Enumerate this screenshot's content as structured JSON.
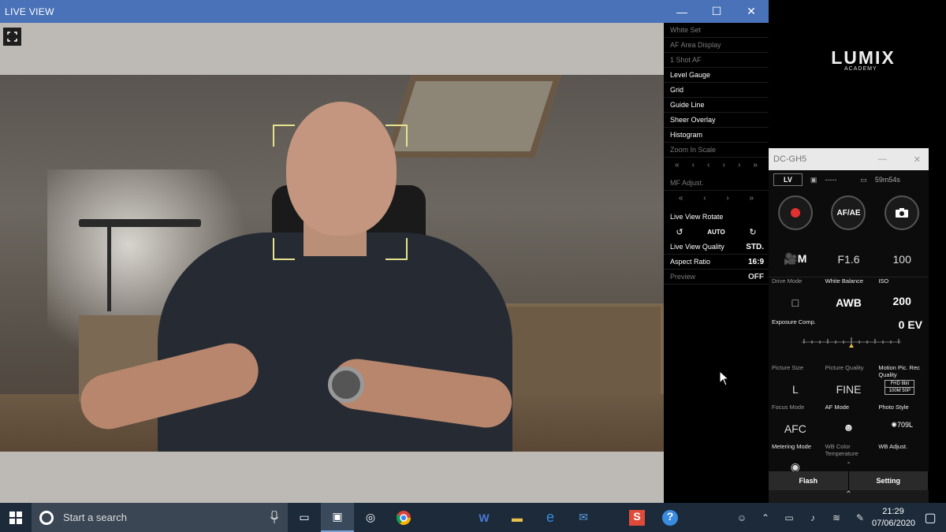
{
  "live_view_window": {
    "title": "LIVE VIEW",
    "window_buttons": {
      "minimize": "—",
      "maximize": "☐",
      "close": "✕"
    }
  },
  "settings_panel": {
    "items": [
      {
        "label": "White Set",
        "dim": true
      },
      {
        "label": "AF Area Display",
        "dim": true
      },
      {
        "label": "1 Shot AF",
        "dim": true
      },
      {
        "label": "Level Gauge",
        "dim": false
      },
      {
        "label": "Grid",
        "dim": false
      },
      {
        "label": "Guide Line",
        "dim": false
      },
      {
        "label": "Sheer Overlay",
        "dim": false
      },
      {
        "label": "Histogram",
        "dim": false
      },
      {
        "label": "Zoom In Scale",
        "dim": true
      }
    ],
    "zoom_arrows": [
      "«",
      "‹",
      "‹",
      "›",
      "›",
      "»"
    ],
    "mf_adjust_label": "MF Adjust.",
    "mf_arrows": [
      "«",
      "‹",
      "›",
      "»"
    ],
    "live_view_rotate_label": "Live View Rotate",
    "rotate_auto": "AUTO",
    "live_view_quality": {
      "label": "Live View Quality",
      "value": "STD."
    },
    "aspect_ratio": {
      "label": "Aspect Ratio",
      "value": "16:9"
    },
    "preview": {
      "label": "Preview",
      "value": "OFF"
    }
  },
  "lumix_logo": {
    "main": "LUMIX",
    "sub": "ACADEMY"
  },
  "gh5_window": {
    "title": "DC-GH5",
    "lv_button": "LV",
    "card_status": "-----",
    "battery_time": "59m54s",
    "af_ae_label": "AF/AE",
    "mode_row": {
      "mode": "M",
      "aperture": "F1.6",
      "shutter": "100"
    },
    "drive_mode": {
      "label": "Drive Mode",
      "value": "□"
    },
    "white_balance": {
      "label": "White Balance",
      "value": "AWB"
    },
    "iso": {
      "label": "ISO",
      "value": "200"
    },
    "exposure_comp": {
      "label": "Exposure Comp.",
      "value": "0 EV"
    },
    "picture_size": {
      "label": "Picture Size",
      "value": "L"
    },
    "picture_quality": {
      "label": "Picture Quality",
      "value": "FINE"
    },
    "motion_pic_quality": {
      "label": "Motion Pic. Rec Quality",
      "value_top": "FHD 8bit",
      "value_bottom": "100M 50P"
    },
    "focus_mode": {
      "label": "Focus Mode",
      "value": "AFC"
    },
    "af_mode": {
      "label": "AF Mode",
      "value": ""
    },
    "photo_style": {
      "label": "Photo Style",
      "value": "709L"
    },
    "metering_mode": {
      "label": "Metering Mode",
      "value": ""
    },
    "wb_color_temp": {
      "label": "WB Color Temperature",
      "value": "-"
    },
    "wb_adjust": {
      "label": "WB Adjust.",
      "value": ""
    },
    "tabs": [
      "Flash",
      "Setting"
    ]
  },
  "taskbar": {
    "search_placeholder": "Start a search",
    "time": "21:29",
    "date": "07/06/2020"
  },
  "colors": {
    "titlebar": "#4a72b8",
    "taskbar": "#1c2a3a",
    "af_frame": "#e6e28e"
  }
}
